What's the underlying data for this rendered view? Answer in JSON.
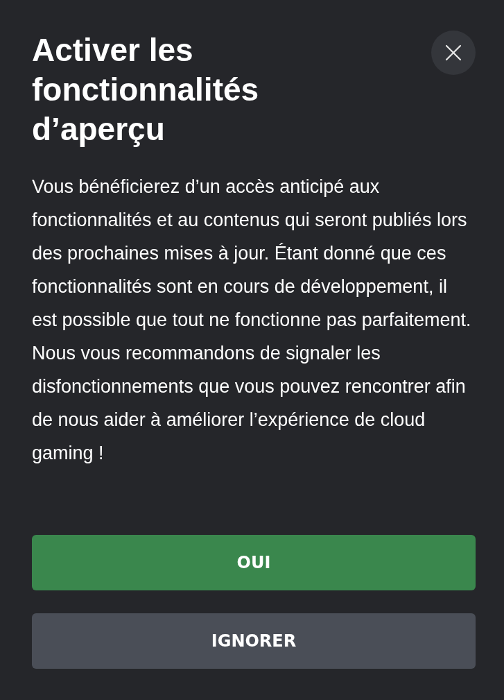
{
  "dialog": {
    "title": "Activer les fonctionnalités d’aperçu",
    "body": "Vous bénéficierez d’un accès anticipé aux fonctionnalités et au contenus qui seront publiés lors des prochaines mises à jour. Étant donné que ces fonctionnalités sont en cours de développement, il est possible que tout ne fonctionne pas parfaitement. Nous vous recommandons de signaler les disfonctionnements que vous pouvez rencontrer afin de nous aider à améliorer l’expérience de cloud gaming !",
    "buttons": [
      {
        "label": "OUI",
        "kind": "primary"
      },
      {
        "label": "IGNORER",
        "kind": "secondary"
      }
    ]
  }
}
